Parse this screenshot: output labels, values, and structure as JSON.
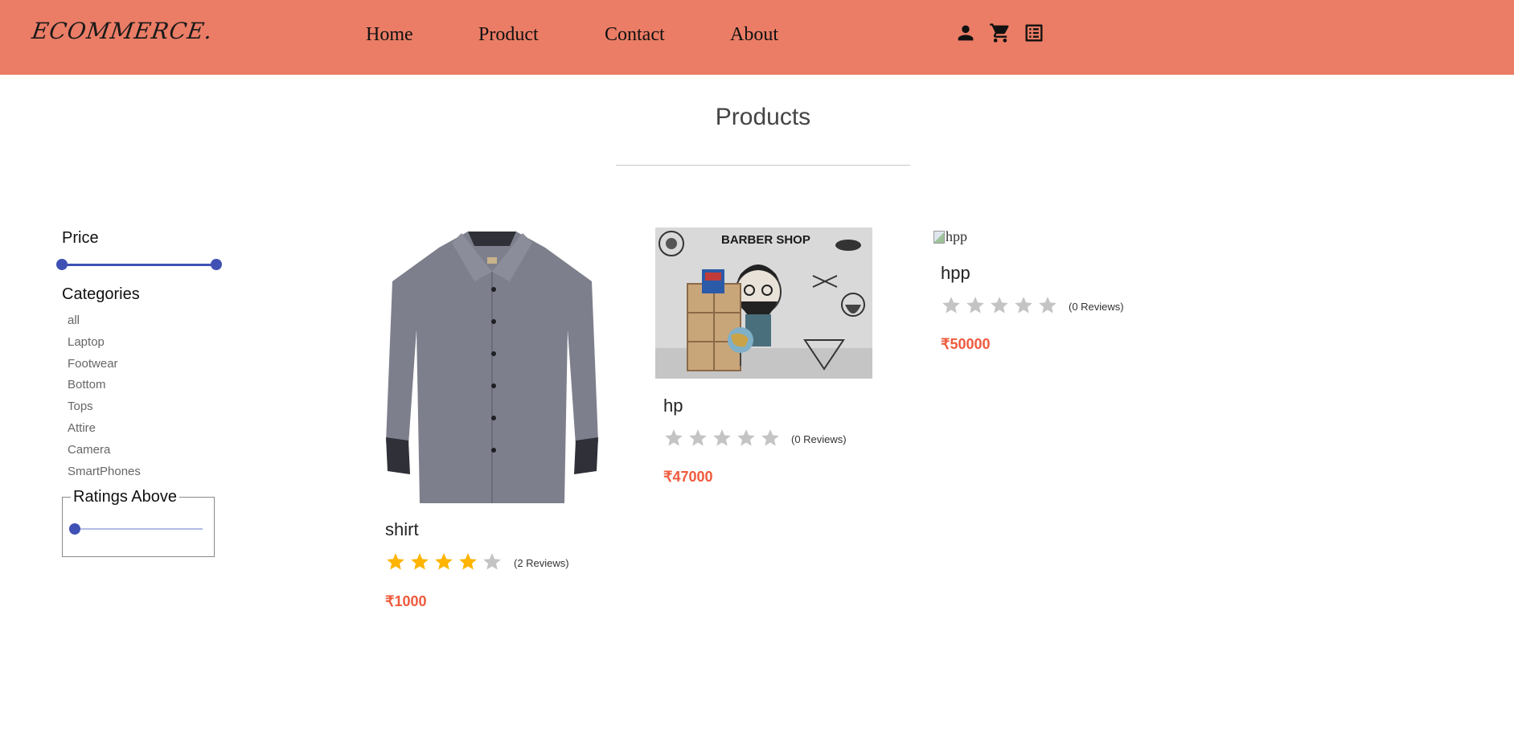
{
  "header": {
    "logo": "ECOMMERCE.",
    "nav": [
      "Home",
      "Product",
      "Contact",
      "About"
    ],
    "icons": [
      "person-icon",
      "cart-icon",
      "orders-list-icon"
    ],
    "background": "#eb7d66"
  },
  "page_title": "Products",
  "filters": {
    "price_heading": "Price",
    "price_range": [
      0,
      1
    ],
    "categories_heading": "Categories",
    "categories": [
      "all",
      "Laptop",
      "Footwear",
      "Bottom",
      "Tops",
      "Attire",
      "Camera",
      "SmartPhones"
    ],
    "ratings_heading": "Ratings Above",
    "ratings_value": 0
  },
  "accent_color": "#3f51b5",
  "star_filled_color": "#ffb400",
  "star_empty_color": "#c4c4c4",
  "price_color": "#ef5a3c",
  "products": [
    {
      "name": "shirt",
      "rating": 4,
      "reviews": "(2 Reviews)",
      "price": "₹1000",
      "image": "grey-shirt"
    },
    {
      "name": "hp",
      "rating": 0,
      "reviews": "(0 Reviews)",
      "price": "₹47000",
      "image": "barber-shop"
    },
    {
      "name": "hpp",
      "rating": 0,
      "reviews": "(0 Reviews)",
      "price": "₹50000",
      "image_alt": "hpp"
    }
  ]
}
